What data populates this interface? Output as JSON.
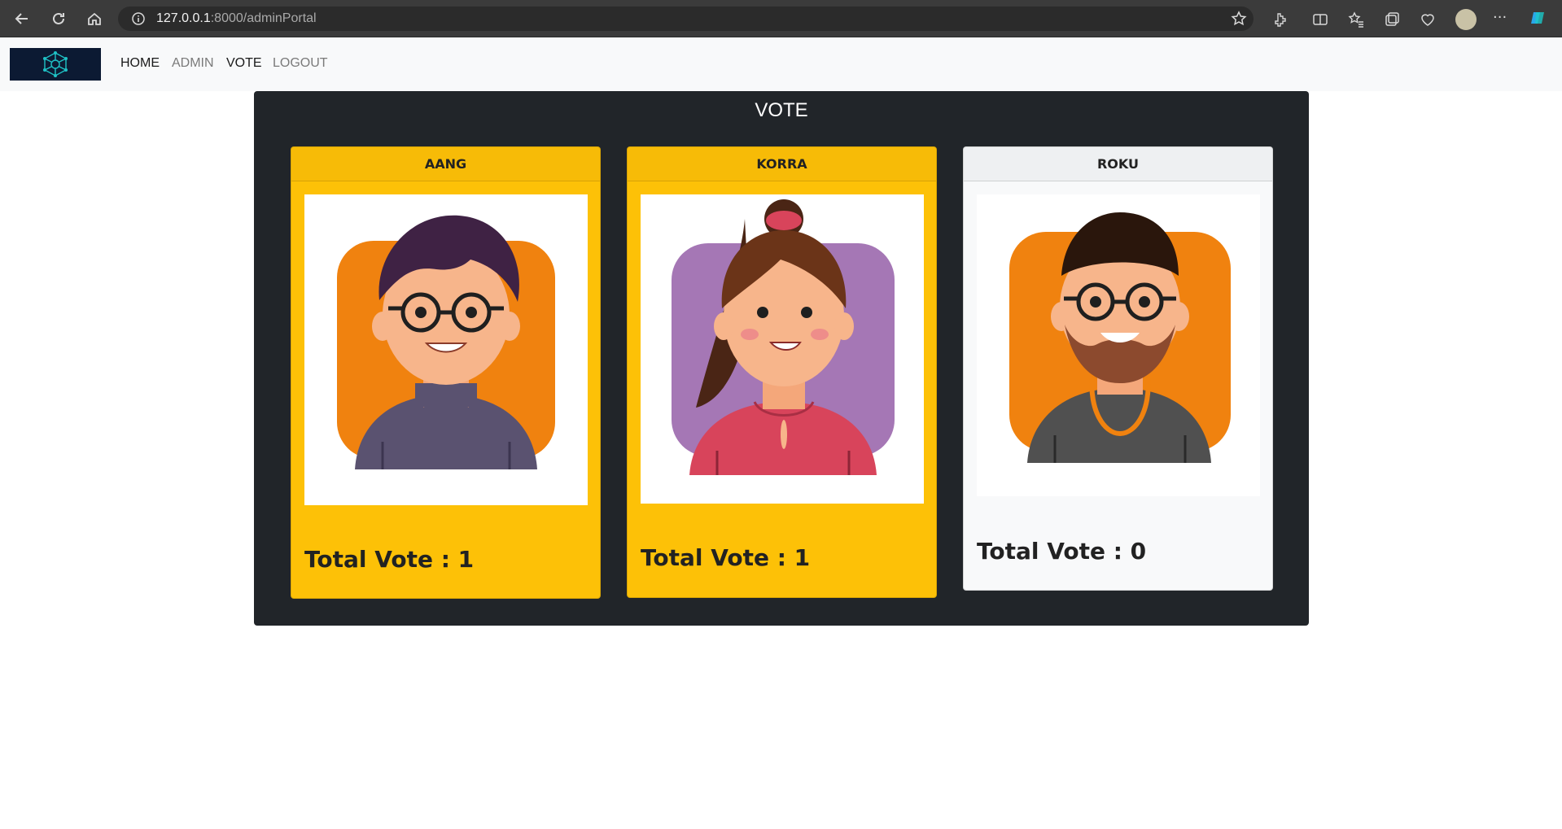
{
  "browser": {
    "url_host": "127.0.0.1",
    "url_path": ":8000/adminPortal"
  },
  "navbar": {
    "logo_icon": "network-logo",
    "links": [
      {
        "label": "HOME",
        "active": true
      },
      {
        "label": "ADMIN",
        "active": false
      },
      {
        "label": "VOTE",
        "active": true
      },
      {
        "label": "LOGOUT",
        "active": false
      }
    ]
  },
  "panel": {
    "title": "VOTE"
  },
  "candidates": [
    {
      "name": "AANG",
      "vote_label": "Total Vote : 1",
      "votes": 1,
      "card_color": "#fdc107",
      "avatar_bg": "#f0820f"
    },
    {
      "name": "KORRA",
      "vote_label": "Total Vote : 1",
      "votes": 1,
      "card_color": "#fdc107",
      "avatar_bg": "#a577b5"
    },
    {
      "name": "ROKU",
      "vote_label": "Total Vote : 0",
      "votes": 0,
      "card_color": "#f8f9fa",
      "avatar_bg": "#f0820f"
    }
  ],
  "colors": {
    "panel_bg": "#212529",
    "navbar_bg": "#f8f9fa",
    "highlight": "#fdc107"
  }
}
